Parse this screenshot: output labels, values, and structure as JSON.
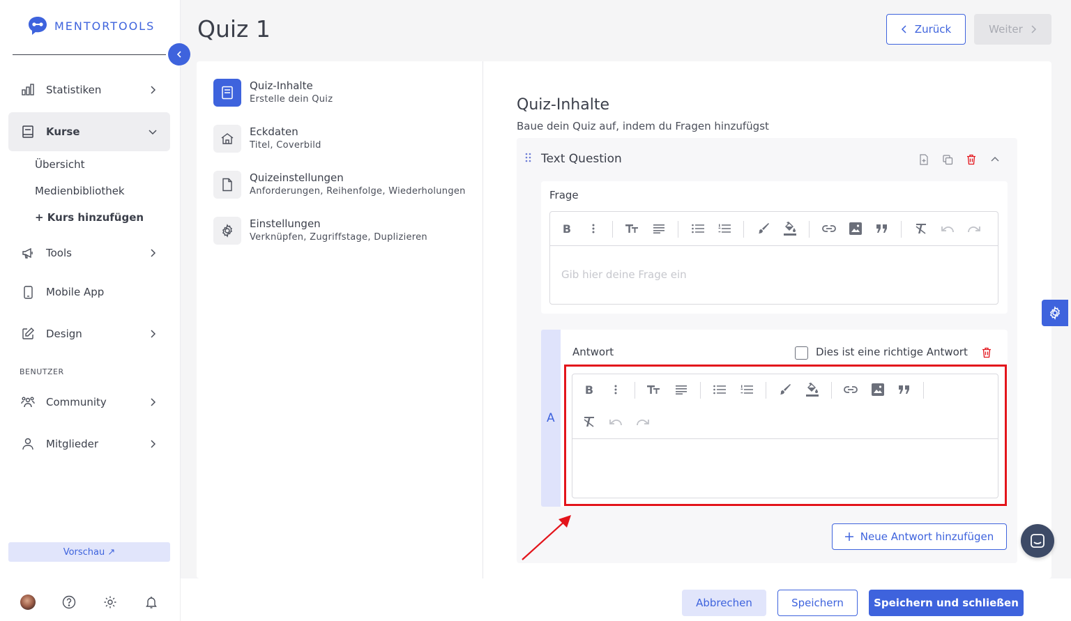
{
  "brand": {
    "name": "MENTORTOOLS",
    "accent": "#3e63dd"
  },
  "sidebar": {
    "items": [
      {
        "label": "Statistiken",
        "icon": "bar-chart-icon"
      },
      {
        "label": "Kurse",
        "icon": "book-icon",
        "active": true,
        "children": [
          {
            "label": "Übersicht"
          },
          {
            "label": "Medienbibliothek"
          },
          {
            "label": "+ Kurs hinzufügen"
          }
        ]
      },
      {
        "label": "Tools",
        "icon": "megaphone-icon"
      },
      {
        "label": "Mobile App",
        "icon": "phone-icon"
      },
      {
        "label": "Design",
        "icon": "edit-icon"
      }
    ],
    "section_label": "BENUTZER",
    "user_items": [
      {
        "label": "Community",
        "icon": "users-icon"
      },
      {
        "label": "Mitglieder",
        "icon": "user-icon"
      }
    ],
    "preview_label": "Vorschau ↗",
    "bottom_icons": [
      "avatar",
      "help-icon",
      "gear-icon",
      "bell-icon"
    ]
  },
  "header": {
    "title": "Quiz 1",
    "back_label": "Zurück",
    "next_label": "Weiter"
  },
  "steps": [
    {
      "title": "Quiz-Inhalte",
      "subtitle": "Erstelle dein Quiz",
      "icon": "document-icon",
      "active": true
    },
    {
      "title": "Eckdaten",
      "subtitle": "Titel, Coverbild",
      "icon": "home-icon"
    },
    {
      "title": "Quizeinstellungen",
      "subtitle": "Anforderungen, Reihenfolge, Wiederholungen",
      "icon": "file-icon"
    },
    {
      "title": "Einstellungen",
      "subtitle": "Verknüpfen, Zugriffstage, Duplizieren",
      "icon": "gear-icon"
    }
  ],
  "content": {
    "title": "Quiz-Inhalte",
    "subtitle": "Baue dein Quiz auf, indem du Fragen hinzufügst",
    "question": {
      "title": "Text Question",
      "frage_label": "Frage",
      "frage_placeholder": "Gib hier deine Frage ein",
      "answer": {
        "letter": "A",
        "label": "Antwort",
        "correct_label": "Dies ist eine richtige Antwort",
        "correct_checked": false
      },
      "add_answer_label": "Neue Antwort hinzufügen"
    }
  },
  "footer": {
    "cancel_label": "Abbrechen",
    "save_label": "Speichern",
    "save_close_label": "Speichern und schließen"
  },
  "colors": {
    "highlight": "#e3141b",
    "accent": "#3e63dd"
  }
}
